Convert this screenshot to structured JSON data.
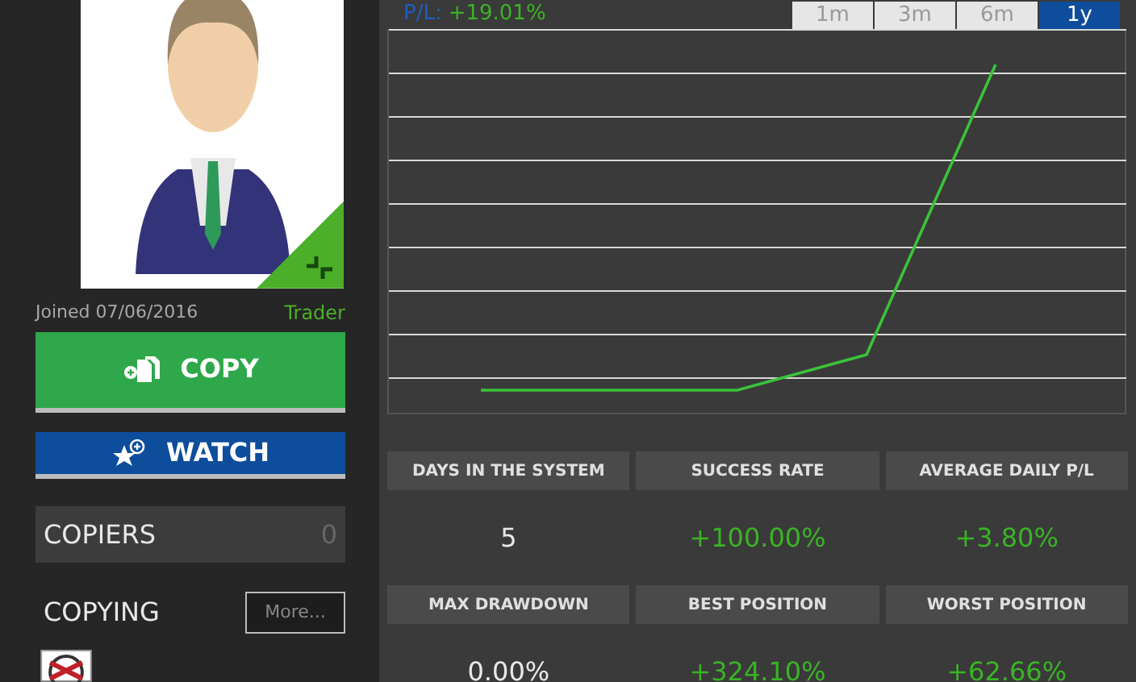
{
  "profile": {
    "joined": "Joined 07/06/2016",
    "role": "Trader"
  },
  "actions": [
    {
      "kind": "copy",
      "label": "COPY"
    },
    {
      "kind": "watch",
      "label": "WATCH"
    }
  ],
  "copiers": {
    "label": "COPIERS",
    "count": "0"
  },
  "copying": {
    "label": "COPYING",
    "more": "More..."
  },
  "pl": {
    "label": "P/L:",
    "value": "+19.01%"
  },
  "periods": [
    {
      "label": "1m",
      "selected": false
    },
    {
      "label": "3m",
      "selected": false
    },
    {
      "label": "6m",
      "selected": false
    },
    {
      "label": "1y",
      "selected": true
    }
  ],
  "stats": [
    {
      "label": "DAYS IN THE SYSTEM",
      "value": "5",
      "positive": false
    },
    {
      "label": "SUCCESS RATE",
      "value": "+100.00%",
      "positive": true
    },
    {
      "label": "AVERAGE DAILY P/L",
      "value": "+3.80%",
      "positive": true
    },
    {
      "label": "MAX DRAWDOWN",
      "value": "0.00%",
      "positive": false
    },
    {
      "label": "BEST POSITION",
      "value": "+324.10%",
      "positive": true
    },
    {
      "label": "WORST POSITION",
      "value": "+62.66%",
      "positive": true
    }
  ]
}
